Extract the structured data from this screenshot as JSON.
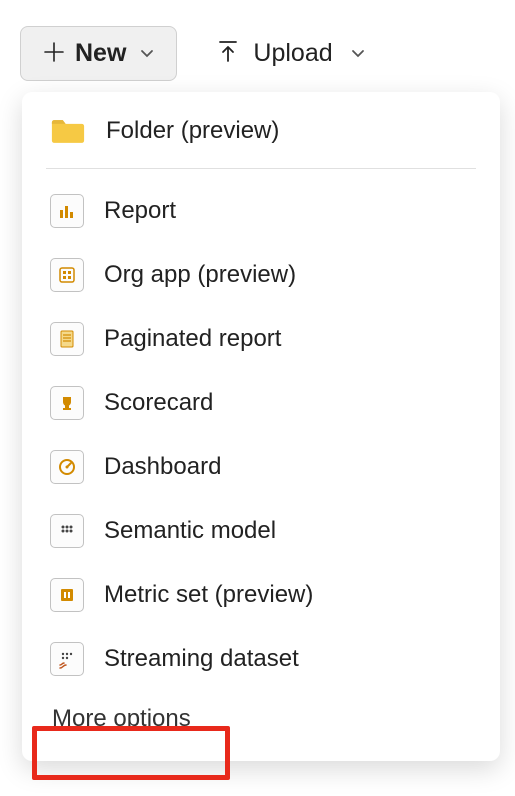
{
  "toolbar": {
    "new_label": "New",
    "upload_label": "Upload"
  },
  "menu": {
    "folder_label": "Folder (preview)",
    "items": [
      {
        "label": "Report",
        "icon": "report-icon"
      },
      {
        "label": "Org app (preview)",
        "icon": "org-app-icon"
      },
      {
        "label": "Paginated report",
        "icon": "paginated-report-icon"
      },
      {
        "label": "Scorecard",
        "icon": "scorecard-icon"
      },
      {
        "label": "Dashboard",
        "icon": "dashboard-icon"
      },
      {
        "label": "Semantic model",
        "icon": "semantic-model-icon"
      },
      {
        "label": "Metric set (preview)",
        "icon": "metric-set-icon"
      },
      {
        "label": "Streaming dataset",
        "icon": "streaming-dataset-icon"
      }
    ],
    "more_options_label": "More options"
  }
}
